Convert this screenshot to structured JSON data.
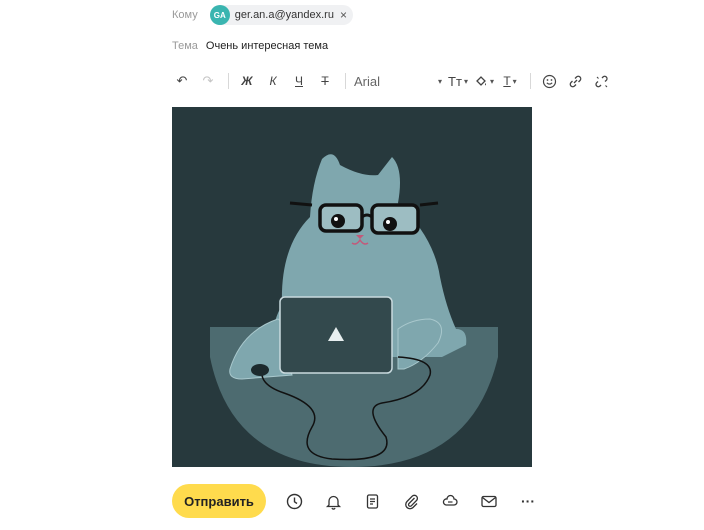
{
  "to": {
    "label": "Кому",
    "recipient": {
      "initials": "GA",
      "email": "ger.an.a@yandex.ru",
      "avatar_color": "#3ab5b0"
    },
    "remove_icon": "×"
  },
  "subject": {
    "label": "Тема",
    "value": "Очень интересная тема"
  },
  "toolbar": {
    "undo_icon": "↶",
    "redo_icon": "↷",
    "bold_label": "Ж",
    "italic_label": "К",
    "underline_label": "Ч",
    "strike_label": "Т",
    "font_name": "Arial",
    "font_size_label": "Tт",
    "text_color_label": "Т",
    "caret": "▾"
  },
  "bottom_bar": {
    "send_label": "Отправить",
    "send_color": "#ffdb4d",
    "icons": [
      "clock-icon",
      "bell-icon",
      "document-icon",
      "paperclip-icon",
      "cloud-attach-icon",
      "mail-icon",
      "more-icon"
    ],
    "more_label": "···"
  },
  "image": {
    "description_icon": "cat-with-laptop-illustration",
    "background_color": "#27393d",
    "cat_color": "#7fa7ae"
  }
}
